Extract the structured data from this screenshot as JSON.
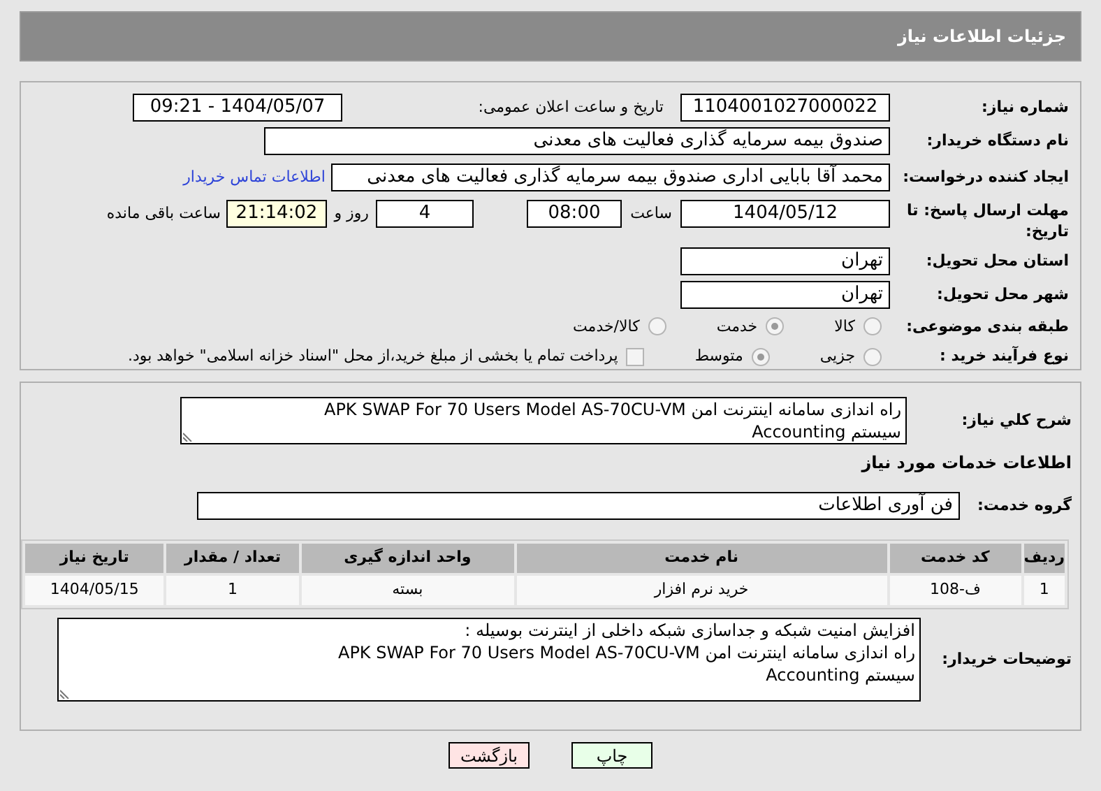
{
  "header": {
    "title": "جزئیات اطلاعات نیاز"
  },
  "fields": {
    "need_number_label": "شماره نیاز:",
    "need_number": "1104001027000022",
    "announce_label": "تاریخ و ساعت اعلان عمومی:",
    "announce": "1404/05/07 - 09:21",
    "buyer_label": "نام دستگاه خریدار:",
    "buyer": "صندوق بیمه سرمایه گذاری فعالیت های معدنی",
    "creator_label": "ایجاد کننده درخواست:",
    "creator": "محمد آقا بابایی اداری صندوق بیمه سرمایه گذاری فعالیت های معدنی",
    "contact_link": "اطلاعات تماس خریدار",
    "deadline_label": "مهلت ارسال پاسخ: تا تاریخ:",
    "deadline_date": "1404/05/12",
    "time_label": "ساعت",
    "deadline_time": "08:00",
    "days": "4",
    "days_label": "روز و",
    "remaining": "21:14:02",
    "remaining_label": "ساعت باقی مانده",
    "province_label": "استان محل تحویل:",
    "province": "تهران",
    "city_label": "شهر محل تحویل:",
    "city": "تهران"
  },
  "category": {
    "label": "طبقه بندی موضوعی:",
    "options": [
      {
        "label": "کالا",
        "selected": false
      },
      {
        "label": "خدمت",
        "selected": true
      },
      {
        "label": "کالا/خدمت",
        "selected": false
      }
    ]
  },
  "process": {
    "label": "نوع فرآیند خرید :",
    "options": [
      {
        "label": "جزیی",
        "selected": false
      },
      {
        "label": "متوسط",
        "selected": true
      }
    ],
    "payment_checkbox": {
      "checked": false,
      "label": "پرداخت تمام یا بخشی از مبلغ خرید،از محل \"اسناد خزانه اسلامی\" خواهد بود."
    }
  },
  "description": {
    "label": "شرح کلي نياز:",
    "lines": [
      "راه اندازی سامانه اینترنت امن APK SWAP For 70 Users Model AS-70CU-VM",
      "سیستم Accounting"
    ]
  },
  "services_title": "اطلاعات خدمات مورد نیاز",
  "service_group": {
    "label": "گروه خدمت:",
    "value": "فن آوری اطلاعات"
  },
  "table": {
    "columns": [
      "ردیف",
      "کد خدمت",
      "نام خدمت",
      "واحد اندازه گیری",
      "تعداد / مقدار",
      "تاریخ نیاز"
    ],
    "rows": [
      [
        "1",
        "ف-108",
        "خرید نرم افزار",
        "بسته",
        "1",
        "1404/05/15"
      ]
    ]
  },
  "buyer_notes": {
    "label": "توضیحات خریدار:",
    "lines": [
      "افزایش امنیت شبکه و جداسازی شبکه داخلی از اینترنت بوسیله :",
      "راه اندازی سامانه اینترنت امن APK SWAP For 70 Users Model AS-70CU-VM",
      "سیستم Accounting"
    ]
  },
  "buttons": [
    {
      "label": "چاپ",
      "kind": "print"
    },
    {
      "label": "بازگشت",
      "kind": "back"
    }
  ]
}
